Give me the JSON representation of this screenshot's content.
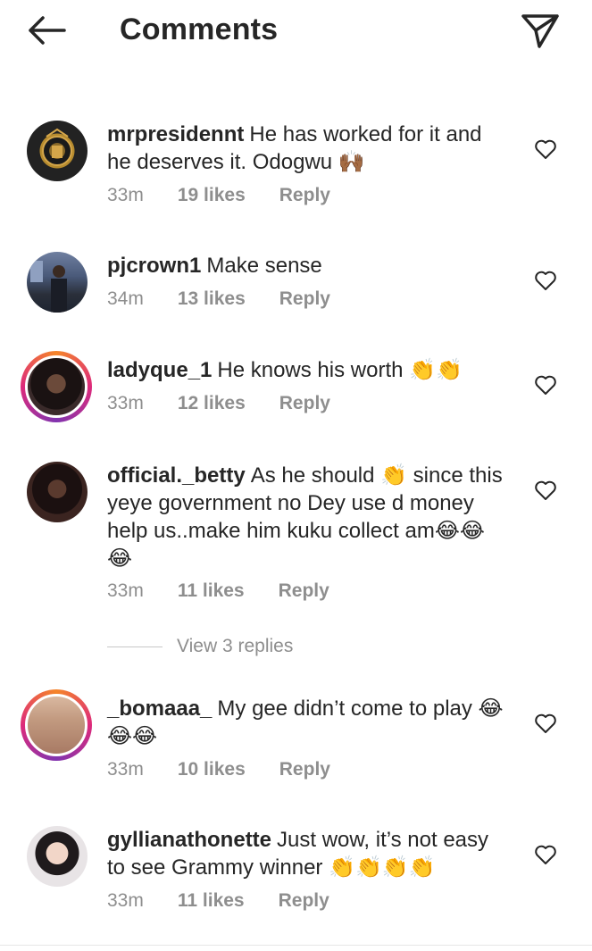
{
  "header": {
    "title": "Comments",
    "back_icon": "arrow-left-icon",
    "send_icon": "paper-plane-icon"
  },
  "comments": [
    {
      "username": "mrpresidennt",
      "text": "He has worked for it and he deserves it. Odogwu 🙌🏾",
      "time": "33m",
      "likes": "19 likes",
      "reply": "Reply",
      "has_story_ring": false
    },
    {
      "username": "pjcrown1",
      "text": "Make sense",
      "time": "34m",
      "likes": "13 likes",
      "reply": "Reply",
      "has_story_ring": false
    },
    {
      "username": "ladyque_1",
      "text": "He knows his worth 👏👏",
      "time": "33m",
      "likes": "12 likes",
      "reply": "Reply",
      "has_story_ring": true
    },
    {
      "username": "official._betty",
      "text": "As he should 👏 since this yeye government no Dey use d money help us..make him kuku collect am😂😂😂",
      "time": "33m",
      "likes": "11 likes",
      "reply": "Reply",
      "has_story_ring": false
    },
    {
      "username": "_bomaaa_",
      "text": "My gee didn’t come to play 😂😂😂",
      "time": "33m",
      "likes": "10 likes",
      "reply": "Reply",
      "has_story_ring": true
    },
    {
      "username": "gyllianathonette",
      "text": "Just wow, it’s not easy to see Grammy winner 👏👏👏👏",
      "time": "33m",
      "likes": "11 likes",
      "reply": "Reply",
      "has_story_ring": false
    }
  ],
  "view_replies": "View 3 replies",
  "colors": {
    "text": "#262626",
    "secondary": "#8e8e8e",
    "ring_start": "#f58529",
    "ring_end": "#dd2a7b"
  }
}
